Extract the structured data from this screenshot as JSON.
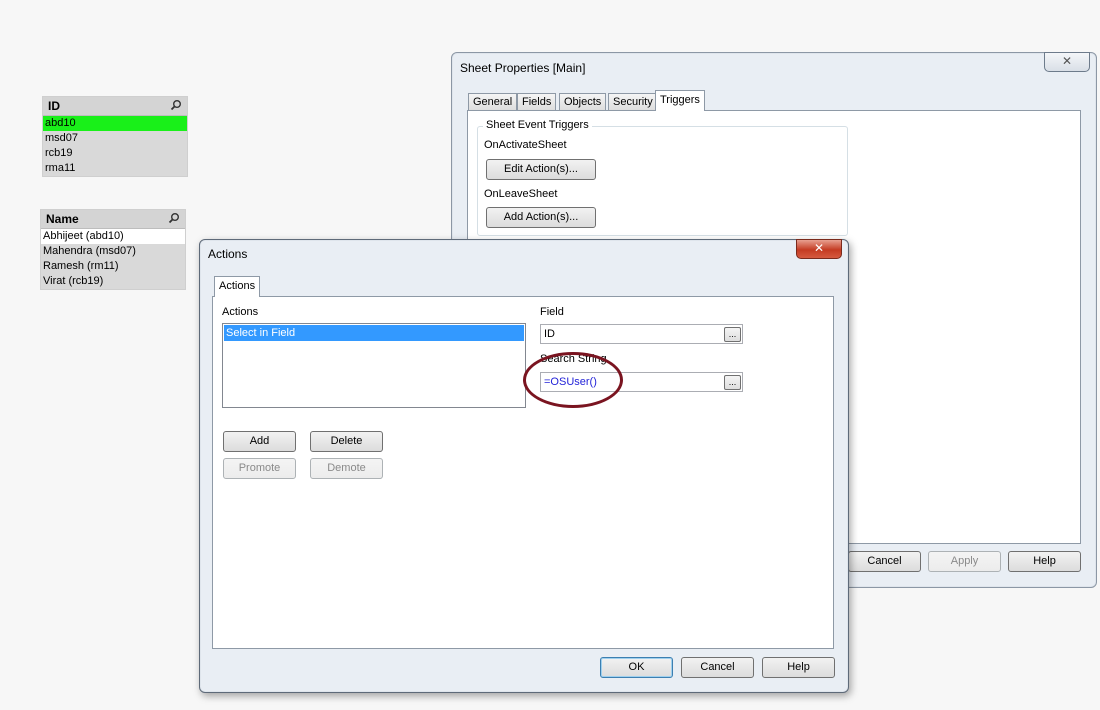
{
  "listbox_id": {
    "title": "ID",
    "rows": [
      {
        "label": "abd10",
        "state": "selected"
      },
      {
        "label": "msd07",
        "state": "excluded"
      },
      {
        "label": "rcb19",
        "state": "excluded"
      },
      {
        "label": "rma11",
        "state": "excluded"
      }
    ]
  },
  "listbox_name": {
    "title": "Name",
    "rows": [
      {
        "label": "Abhijeet (abd10)",
        "state": "possible"
      },
      {
        "label": "Mahendra (msd07)",
        "state": "excluded"
      },
      {
        "label": "Ramesh (rm11)",
        "state": "excluded"
      },
      {
        "label": "Virat (rcb19)",
        "state": "excluded"
      }
    ]
  },
  "sheet_properties": {
    "title": "Sheet Properties [Main]",
    "tabs": [
      "General",
      "Fields",
      "Objects",
      "Security",
      "Triggers"
    ],
    "active_tab": "Triggers",
    "group_title": "Sheet Event Triggers",
    "on_activate_label": "OnActivateSheet",
    "edit_actions_label": "Edit Action(s)...",
    "on_leave_label": "OnLeaveSheet",
    "add_actions_label": "Add Action(s)...",
    "cancel_label": "Cancel",
    "apply_label": "Apply",
    "help_label": "Help"
  },
  "actions_dialog": {
    "title": "Actions",
    "tab": "Actions",
    "actions_label": "Actions",
    "action_items": [
      "Select in Field"
    ],
    "field_label": "Field",
    "field_value": "ID",
    "search_string_label": "Search String",
    "search_string_value": "=OSUser()",
    "ellipsis": "...",
    "add_label": "Add",
    "delete_label": "Delete",
    "promote_label": "Promote",
    "demote_label": "Demote",
    "ok_label": "OK",
    "cancel_label": "Cancel",
    "help_label": "Help"
  },
  "colors": {
    "selected": "#19f019",
    "possible": "#ffffff",
    "excluded": "#d9d9d9",
    "annotation": "#7a1420",
    "close_active": "#c43b22"
  },
  "icons": {
    "close": "✕",
    "search": "magnifier"
  }
}
